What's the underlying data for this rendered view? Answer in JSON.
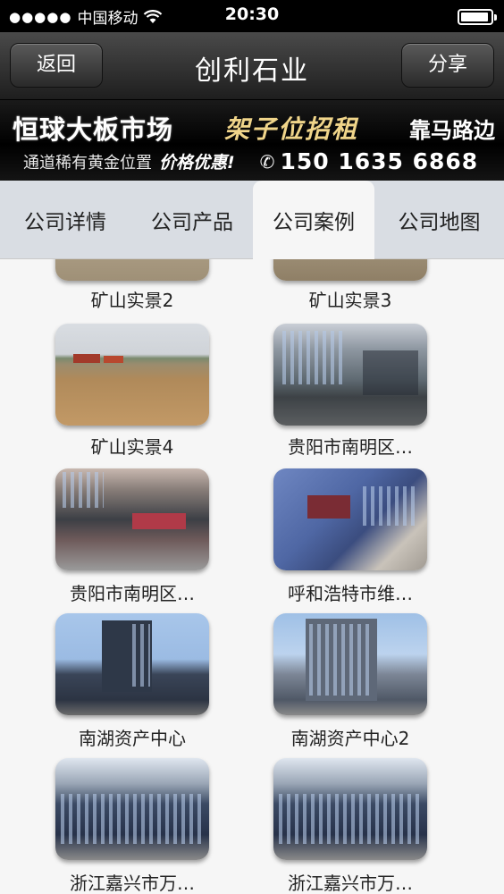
{
  "status_bar": {
    "carrier": "中国移动",
    "time": "20:30"
  },
  "nav": {
    "back_label": "返回",
    "title": "创利石业",
    "share_label": "分享"
  },
  "banner": {
    "title": "恒球大板市场",
    "highlight": "架子位招租",
    "road": "靠马路边",
    "subtitle": "通道稀有黄金位置",
    "price": "价格优惠!",
    "phone": "150 1635 6868"
  },
  "tabs": [
    {
      "label": "公司详情",
      "active": false
    },
    {
      "label": "公司产品",
      "active": false
    },
    {
      "label": "公司案例",
      "active": true
    },
    {
      "label": "公司地图",
      "active": false
    }
  ],
  "cases": [
    {
      "caption": "矿山实景2",
      "image": "quarry-rock"
    },
    {
      "caption": "矿山实景3",
      "image": "quarry-rock"
    },
    {
      "caption": "矿山实景4",
      "image": "mine-site"
    },
    {
      "caption": "贵阳市南明区…",
      "image": "street-building"
    },
    {
      "caption": "贵阳市南明区…",
      "image": "shopfront-building"
    },
    {
      "caption": "呼和浩特市维…",
      "image": "blue-building"
    },
    {
      "caption": "南湖资产中心",
      "image": "office-tower"
    },
    {
      "caption": "南湖资产中心2",
      "image": "office-tower"
    },
    {
      "caption": "浙江嘉兴市万…",
      "image": "mall-building"
    },
    {
      "caption": "浙江嘉兴市万…",
      "image": "mall-building"
    }
  ]
}
